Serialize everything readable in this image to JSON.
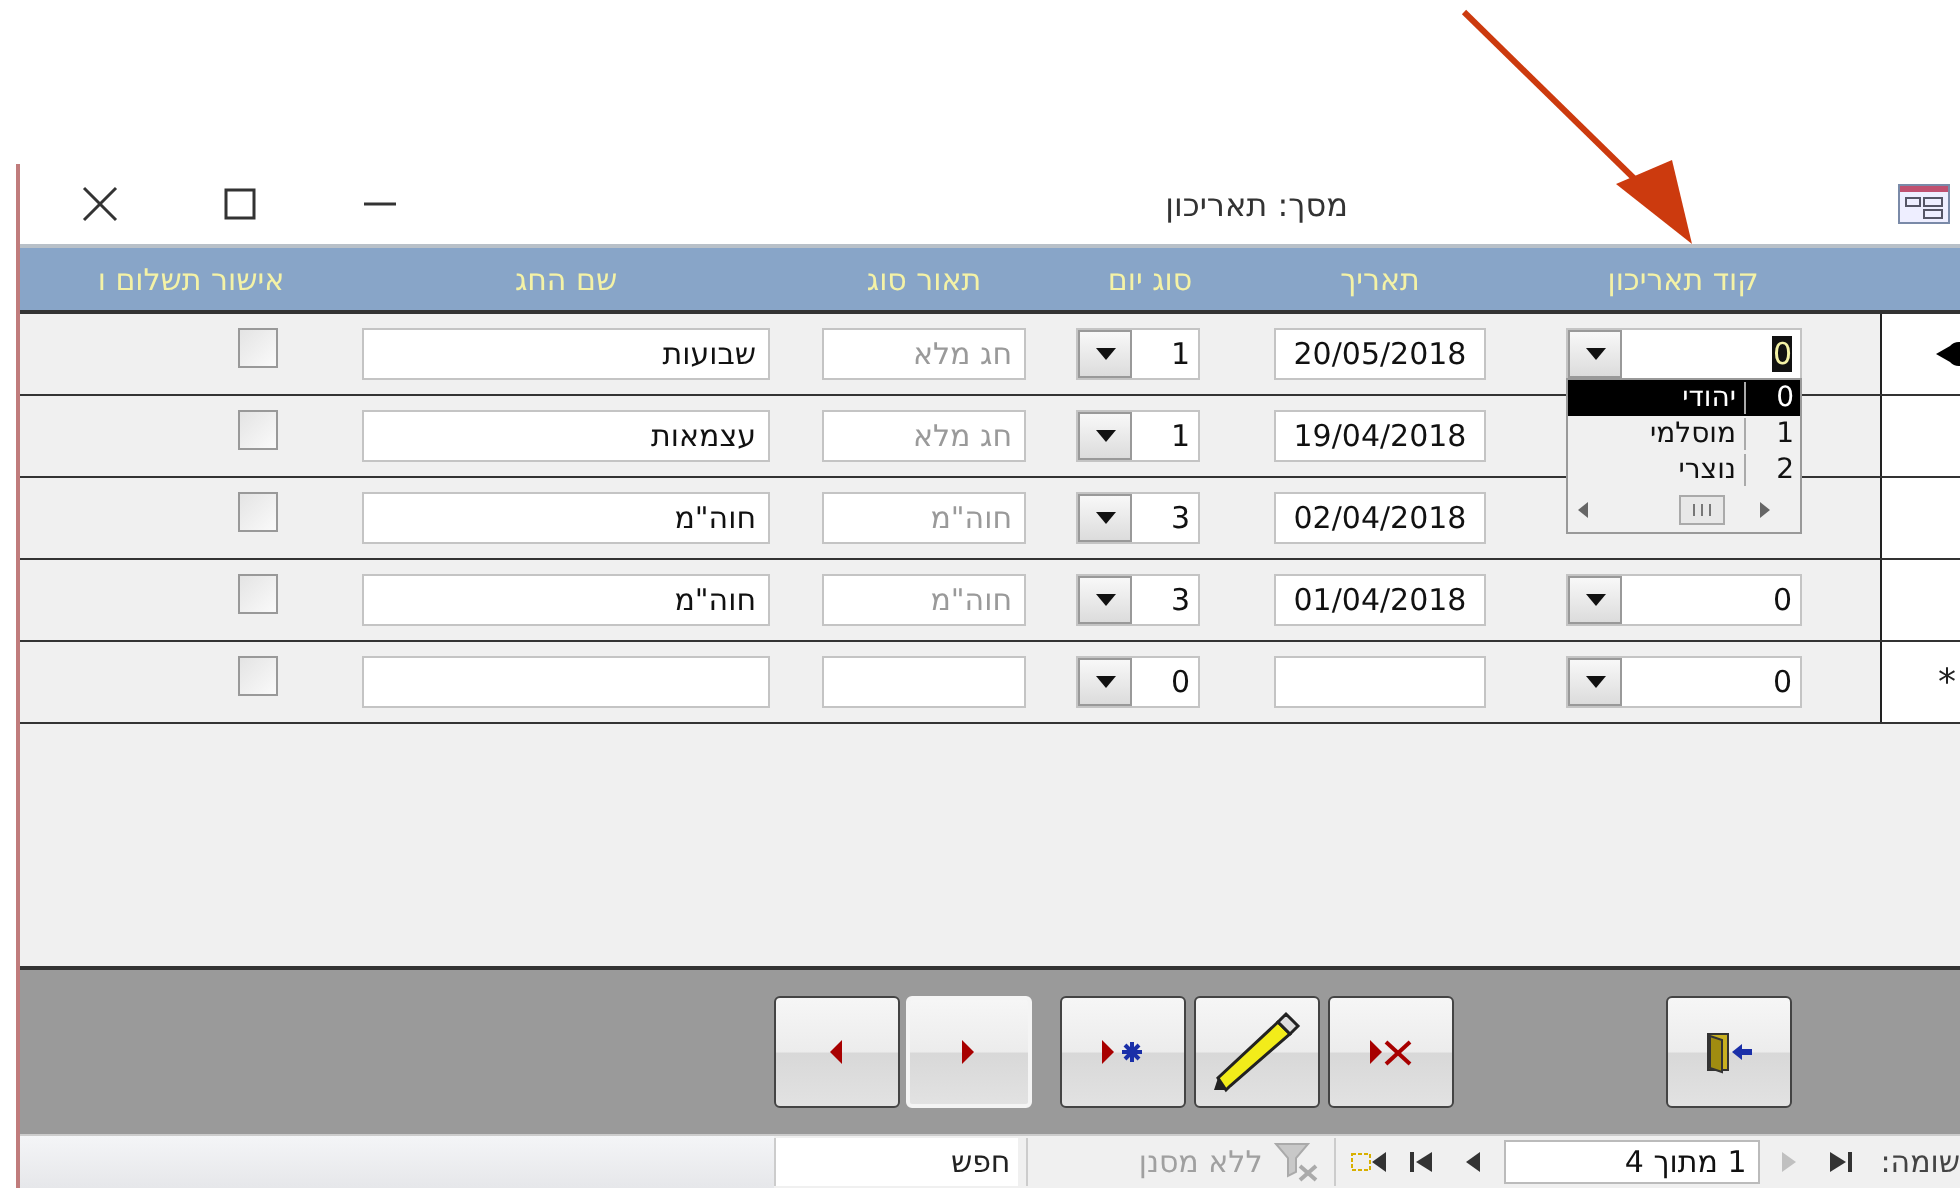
{
  "window": {
    "title": "מסך: תאריכון"
  },
  "columns": [
    "קוד תאריכון",
    "תאריך",
    "סוג יום",
    "תאור סוג",
    "שם החג",
    "אישור תשלום ו"
  ],
  "rows": [
    {
      "kind": "record",
      "current": true,
      "code": "0",
      "date": "20/05/2018",
      "day_type": "1",
      "type_description": "חג מלא",
      "holiday_name": "שבועות",
      "payment_approved": false,
      "code_dropdown": {
        "options": [
          {
            "value": "0",
            "label": "יהודי",
            "selected": true
          },
          {
            "value": "1",
            "label": "מוסלמי",
            "selected": false
          },
          {
            "value": "2",
            "label": "נוצרי",
            "selected": false
          }
        ]
      }
    },
    {
      "kind": "record",
      "current": false,
      "date": "19/04/2018",
      "day_type": "1",
      "type_description": "חג מלא",
      "holiday_name": "עצמאות",
      "payment_approved": false
    },
    {
      "kind": "record",
      "current": false,
      "date": "02/04/2018",
      "day_type": "3",
      "type_description": "חוה\"מ",
      "holiday_name": "חוה\"מ",
      "payment_approved": false
    },
    {
      "kind": "record",
      "current": false,
      "code": "0",
      "date": "01/04/2018",
      "day_type": "3",
      "type_description": "חוה\"מ",
      "holiday_name": "חוה\"מ",
      "payment_approved": false
    },
    {
      "kind": "new",
      "current": false,
      "marker": "*",
      "code": "0",
      "day_type": "0",
      "payment_approved": false
    }
  ],
  "buttons": [
    {
      "kind": "exit",
      "focused": false
    },
    {
      "kind": "delete",
      "focused": false
    },
    {
      "kind": "edit",
      "focused": false
    },
    {
      "kind": "new",
      "focused": false
    },
    {
      "kind": "right",
      "focused": true
    },
    {
      "kind": "left",
      "focused": false
    }
  ],
  "status_bar": {
    "record_label": "שומה:",
    "nav_before": [
      {
        "kind": "first",
        "disabled": false
      },
      {
        "kind": "previous",
        "disabled": true
      }
    ],
    "position": "1 מתוך 4",
    "nav_after": [
      {
        "kind": "next",
        "disabled": false
      },
      {
        "kind": "last",
        "disabled": false
      },
      {
        "kind": "new",
        "disabled": false
      }
    ],
    "filter": {
      "label": "ללא מסנן",
      "disabled": true
    },
    "search": {
      "placeholder": "חפש"
    }
  }
}
